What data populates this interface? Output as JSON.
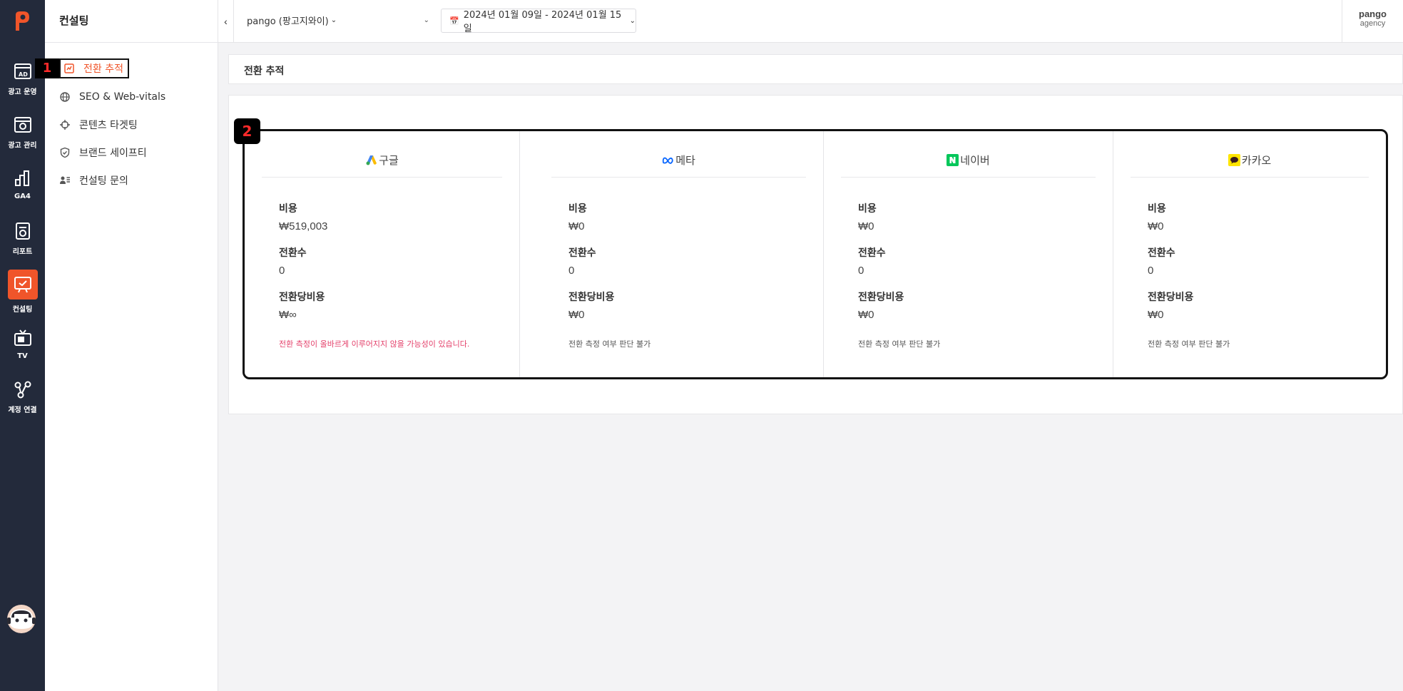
{
  "rail": {
    "items": [
      {
        "label": "광고 운영",
        "icon": "ad-board-icon"
      },
      {
        "label": "광고 관리",
        "icon": "ad-settings-icon"
      },
      {
        "label": "GA4",
        "icon": "ga4-icon"
      },
      {
        "label": "리포트",
        "icon": "report-icon"
      },
      {
        "label": "컨설팅",
        "icon": "consulting-icon",
        "active": true
      },
      {
        "label": "TV",
        "icon": "tv-icon"
      },
      {
        "label": "계정 연결",
        "icon": "account-link-icon"
      }
    ],
    "accent": "#f0552a",
    "bg": "#232a3b"
  },
  "sidenav": {
    "title": "컨설팅",
    "items": [
      {
        "label": "전환 추적",
        "icon": "conversion-icon",
        "active": true
      },
      {
        "label": "SEO & Web-vitals",
        "icon": "globe-icon"
      },
      {
        "label": "콘텐츠 타겟팅",
        "icon": "crosshair-icon"
      },
      {
        "label": "브랜드 세이프티",
        "icon": "shield-icon"
      },
      {
        "label": "컨설팅 문의",
        "icon": "contact-icon"
      }
    ]
  },
  "annotations": {
    "one": "1",
    "two": "2"
  },
  "header": {
    "account": "pango (팡고지와이)",
    "date_range": "2024년 01월 09일 - 2024년 01월 15일",
    "user_name": "pango",
    "user_role": "agency"
  },
  "breadcrumb": "전환 추적",
  "cards": [
    {
      "platform": "구글",
      "icon": "google-ads-icon",
      "cost_label": "비용",
      "cost": "₩519,003",
      "conv_label": "전환수",
      "conv": "0",
      "cpa_label": "전환당비용",
      "cpa": "₩∞",
      "note": "전환 측정이 올바르게 이루어지지 않을 가능성이 있습니다.",
      "warn": true
    },
    {
      "platform": "메타",
      "icon": "meta-icon",
      "cost_label": "비용",
      "cost": "₩0",
      "conv_label": "전환수",
      "conv": "0",
      "cpa_label": "전환당비용",
      "cpa": "₩0",
      "note": "전환 측정 여부 판단 불가",
      "warn": false
    },
    {
      "platform": "네이버",
      "icon": "naver-icon",
      "cost_label": "비용",
      "cost": "₩0",
      "conv_label": "전환수",
      "conv": "0",
      "cpa_label": "전환당비용",
      "cpa": "₩0",
      "note": "전환 측정 여부 판단 불가",
      "warn": false
    },
    {
      "platform": "카카오",
      "icon": "kakao-icon",
      "cost_label": "비용",
      "cost": "₩0",
      "conv_label": "전환수",
      "conv": "0",
      "cpa_label": "전환당비용",
      "cpa": "₩0",
      "note": "전환 측정 여부 판단 불가",
      "warn": false
    }
  ],
  "colors": {
    "warn": "#e4416b",
    "naver": "#03c75a",
    "kakao": "#fee500",
    "meta": "#0866ff"
  }
}
